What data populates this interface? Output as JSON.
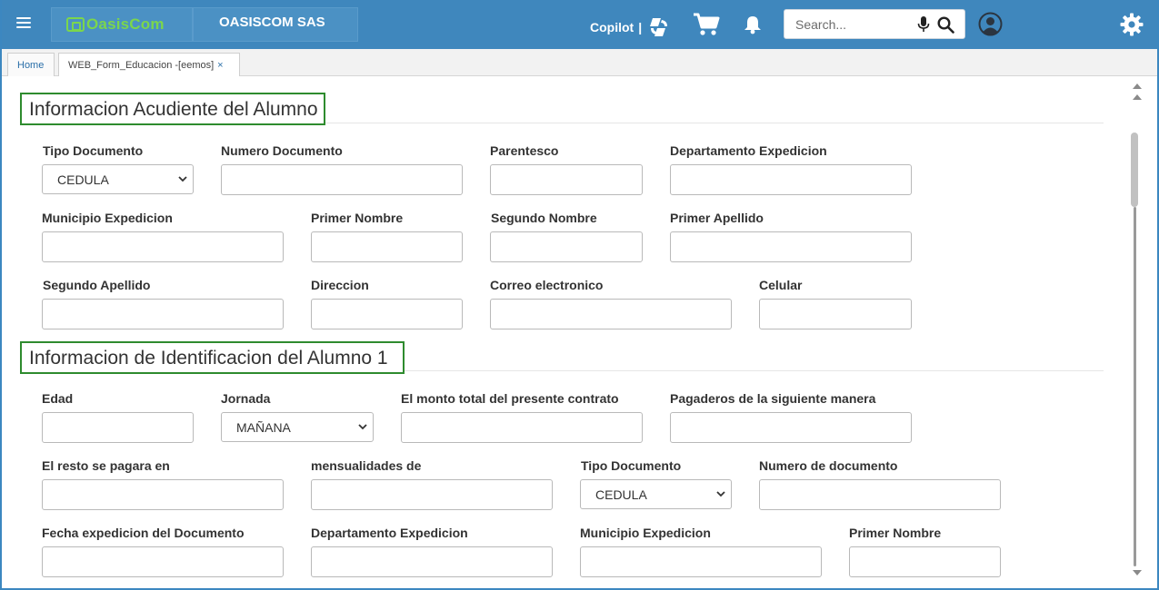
{
  "header": {
    "logo_text": "OasisCom",
    "company_name": "OASISCOM SAS",
    "copilot_label": "Copilot",
    "copilot_separator": "|",
    "search_placeholder": "Search...",
    "brand_color": "#3f87bd",
    "logo_color": "#7bd64c"
  },
  "tabs": [
    {
      "label": "Home"
    },
    {
      "label": "WEB_Form_Educacion -[eemos]",
      "close": "×"
    }
  ],
  "section1": {
    "title": "Informacion Acudiente del Alumno",
    "fields": {
      "tipo_documento": {
        "label": "Tipo Documento",
        "value": "CEDULA"
      },
      "numero_documento": {
        "label": "Numero Documento",
        "value": ""
      },
      "parentesco": {
        "label": "Parentesco",
        "value": ""
      },
      "departamento_expedicion": {
        "label": "Departamento Expedicion",
        "value": ""
      },
      "municipio_expedicion": {
        "label": "Municipio Expedicion",
        "value": ""
      },
      "primer_nombre": {
        "label": "Primer Nombre",
        "value": ""
      },
      "segundo_nombre": {
        "label": "Segundo Nombre",
        "value": ""
      },
      "primer_apellido": {
        "label": "Primer Apellido",
        "value": ""
      },
      "segundo_apellido": {
        "label": "Segundo Apellido",
        "value": ""
      },
      "direccion": {
        "label": "Direccion",
        "value": ""
      },
      "correo": {
        "label": "Correo electronico",
        "value": ""
      },
      "celular": {
        "label": "Celular",
        "value": ""
      }
    }
  },
  "section2": {
    "title": "Informacion de Identificacion del Alumno 1",
    "fields": {
      "edad": {
        "label": "Edad",
        "value": ""
      },
      "jornada": {
        "label": "Jornada",
        "value": "MAÑANA"
      },
      "monto_total": {
        "label": "El monto total del presente contrato",
        "value": ""
      },
      "pagaderos": {
        "label": "Pagaderos de la siguiente manera",
        "value": ""
      },
      "resto": {
        "label": "El resto se pagara en",
        "value": ""
      },
      "mensualidades": {
        "label": "mensualidades de",
        "value": ""
      },
      "tipo_documento": {
        "label": "Tipo Documento",
        "value": "CEDULA"
      },
      "numero_documento": {
        "label": "Numero de documento",
        "value": ""
      },
      "fecha_expedicion": {
        "label": "Fecha expedicion del Documento",
        "value": ""
      },
      "departamento_expedicion": {
        "label": "Departamento Expedicion",
        "value": ""
      },
      "municipio_expedicion": {
        "label": "Municipio Expedicion",
        "value": ""
      },
      "primer_nombre": {
        "label": "Primer Nombre",
        "value": ""
      }
    }
  }
}
